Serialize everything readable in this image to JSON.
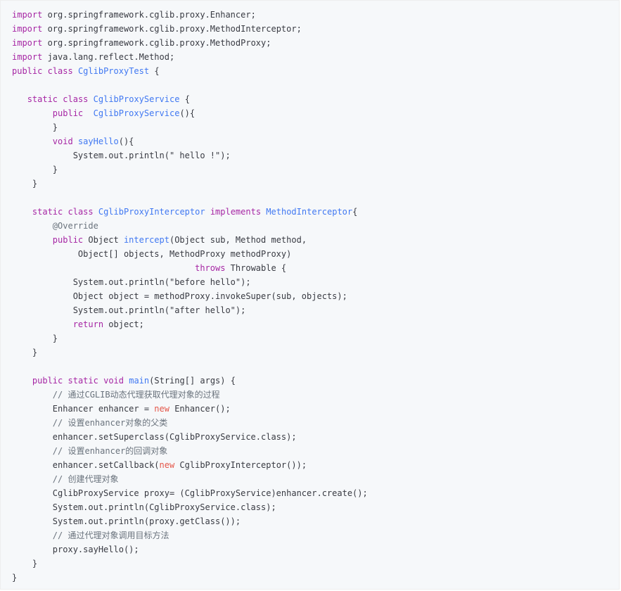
{
  "code": {
    "lines": [
      [
        {
          "t": "import",
          "c": "kw"
        },
        {
          "t": " org.springframework.cglib.proxy.Enhancer;"
        }
      ],
      [
        {
          "t": "import",
          "c": "kw"
        },
        {
          "t": " org.springframework.cglib.proxy.MethodInterceptor;"
        }
      ],
      [
        {
          "t": "import",
          "c": "kw"
        },
        {
          "t": " org.springframework.cglib.proxy.MethodProxy;"
        }
      ],
      [
        {
          "t": "import",
          "c": "kw"
        },
        {
          "t": " java.lang.reflect.Method;"
        }
      ],
      [
        {
          "t": "public",
          "c": "kw"
        },
        {
          "t": " "
        },
        {
          "t": "class",
          "c": "kw"
        },
        {
          "t": " "
        },
        {
          "t": "CglibProxyTest",
          "c": "ty"
        },
        {
          "t": " {"
        }
      ],
      [],
      [
        {
          "t": "   "
        },
        {
          "t": "static",
          "c": "kw"
        },
        {
          "t": " "
        },
        {
          "t": "class",
          "c": "kw"
        },
        {
          "t": " "
        },
        {
          "t": "CglibProxyService",
          "c": "ty"
        },
        {
          "t": " {"
        }
      ],
      [
        {
          "t": "        "
        },
        {
          "t": "public",
          "c": "kw"
        },
        {
          "t": "  "
        },
        {
          "t": "CglibProxyService",
          "c": "ty"
        },
        {
          "t": "(){"
        }
      ],
      [
        {
          "t": "        }"
        }
      ],
      [
        {
          "t": "        "
        },
        {
          "t": "void",
          "c": "kw"
        },
        {
          "t": " "
        },
        {
          "t": "sayHello",
          "c": "ty"
        },
        {
          "t": "(){"
        }
      ],
      [
        {
          "t": "            System.out.println("
        },
        {
          "t": "\" hello !\"",
          "c": "str"
        },
        {
          "t": ");"
        }
      ],
      [
        {
          "t": "        }"
        }
      ],
      [
        {
          "t": "    }"
        }
      ],
      [],
      [
        {
          "t": "    "
        },
        {
          "t": "static",
          "c": "kw"
        },
        {
          "t": " "
        },
        {
          "t": "class",
          "c": "kw"
        },
        {
          "t": " "
        },
        {
          "t": "CglibProxyInterceptor",
          "c": "ty"
        },
        {
          "t": " "
        },
        {
          "t": "implements",
          "c": "kw"
        },
        {
          "t": " "
        },
        {
          "t": "MethodInterceptor",
          "c": "ty"
        },
        {
          "t": "{"
        }
      ],
      [
        {
          "t": "        "
        },
        {
          "t": "@Override",
          "c": "an"
        }
      ],
      [
        {
          "t": "        "
        },
        {
          "t": "public",
          "c": "kw"
        },
        {
          "t": " Object "
        },
        {
          "t": "intercept",
          "c": "ty"
        },
        {
          "t": "(Object sub, Method method,"
        }
      ],
      [
        {
          "t": "             Object[] objects, MethodProxy methodProxy)"
        }
      ],
      [
        {
          "t": "                                    "
        },
        {
          "t": "throws",
          "c": "kw"
        },
        {
          "t": " Throwable {"
        }
      ],
      [
        {
          "t": "            System.out.println("
        },
        {
          "t": "\"before hello\"",
          "c": "str"
        },
        {
          "t": ");"
        }
      ],
      [
        {
          "t": "            Object object = methodProxy.invokeSuper(sub, objects);"
        }
      ],
      [
        {
          "t": "            System.out.println("
        },
        {
          "t": "\"after hello\"",
          "c": "str"
        },
        {
          "t": ");"
        }
      ],
      [
        {
          "t": "            "
        },
        {
          "t": "return",
          "c": "kw"
        },
        {
          "t": " object;"
        }
      ],
      [
        {
          "t": "        }"
        }
      ],
      [
        {
          "t": "    }"
        }
      ],
      [],
      [
        {
          "t": "    "
        },
        {
          "t": "public",
          "c": "kw"
        },
        {
          "t": " "
        },
        {
          "t": "static",
          "c": "kw"
        },
        {
          "t": " "
        },
        {
          "t": "void",
          "c": "kw"
        },
        {
          "t": " "
        },
        {
          "t": "main",
          "c": "ty"
        },
        {
          "t": "(String[] args) {"
        }
      ],
      [
        {
          "t": "        "
        },
        {
          "t": "// 通过CGLIB动态代理获取代理对象的过程",
          "c": "cm"
        }
      ],
      [
        {
          "t": "        Enhancer enhancer = "
        },
        {
          "t": "new",
          "c": "nw"
        },
        {
          "t": " Enhancer();"
        }
      ],
      [
        {
          "t": "        "
        },
        {
          "t": "// 设置enhancer对象的父类",
          "c": "cm"
        }
      ],
      [
        {
          "t": "        enhancer.setSuperclass(CglibProxyService.class);"
        }
      ],
      [
        {
          "t": "        "
        },
        {
          "t": "// 设置enhancer的回调对象",
          "c": "cm"
        }
      ],
      [
        {
          "t": "        enhancer.setCallback("
        },
        {
          "t": "new",
          "c": "nw"
        },
        {
          "t": " CglibProxyInterceptor());"
        }
      ],
      [
        {
          "t": "        "
        },
        {
          "t": "// 创建代理对象",
          "c": "cm"
        }
      ],
      [
        {
          "t": "        CglibProxyService proxy= (CglibProxyService)enhancer.create();"
        }
      ],
      [
        {
          "t": "        System.out.println(CglibProxyService.class);"
        }
      ],
      [
        {
          "t": "        System.out.println(proxy.getClass());"
        }
      ],
      [
        {
          "t": "        "
        },
        {
          "t": "// 通过代理对象调用目标方法",
          "c": "cm"
        }
      ],
      [
        {
          "t": "        proxy.sayHello();"
        }
      ],
      [
        {
          "t": "    }"
        }
      ],
      [
        {
          "t": "}"
        }
      ]
    ]
  }
}
